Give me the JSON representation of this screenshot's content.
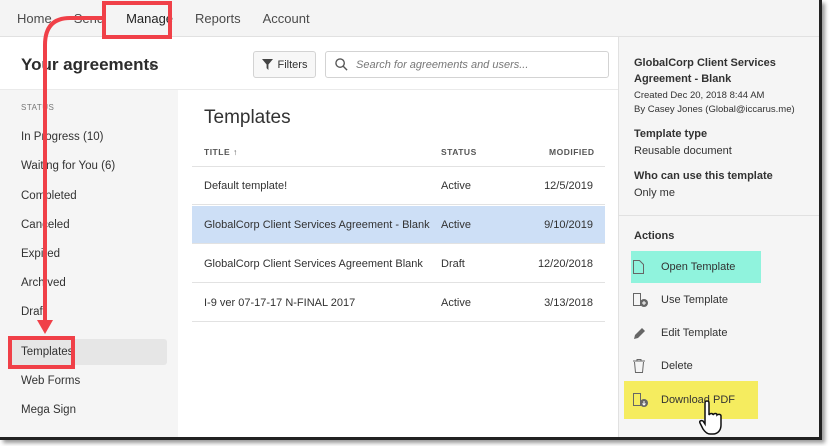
{
  "topnav": [
    "Home",
    "Send",
    "Manage",
    "Reports",
    "Account"
  ],
  "header": {
    "title": "Your agreements",
    "filters": "Filters",
    "search_placeholder": "Search for agreements and users..."
  },
  "sidebar": {
    "section": "STATUS",
    "items": [
      "In Progress (10)",
      "Waiting for You (6)",
      "Completed",
      "Canceled",
      "Expired",
      "Archived",
      "Draft",
      "Templates",
      "Web Forms",
      "Mega Sign"
    ],
    "selected": "Templates"
  },
  "main": {
    "title": "Templates",
    "columns": [
      "TITLE",
      "STATUS",
      "MODIFIED"
    ],
    "rows": [
      {
        "title": "Default template!",
        "status": "Active",
        "modified": "12/5/2019"
      },
      {
        "title": "GlobalCorp Client Services Agreement - Blank",
        "status": "Active",
        "modified": "9/10/2019"
      },
      {
        "title": "GlobalCorp Client Services Agreement Blank",
        "status": "Draft",
        "modified": "12/20/2018"
      },
      {
        "title": "I-9 ver 07-17-17 N-FINAL 2017",
        "status": "Active",
        "modified": "3/13/2018"
      }
    ]
  },
  "details": {
    "name": "GlobalCorp Client Services Agreement - Blank",
    "created": "Created Dec 20, 2018 8:44 AM",
    "by": "By Casey Jones (Global@iccarus.me)",
    "type_label": "Template type",
    "type_value": "Reusable document",
    "who_label": "Who can use this template",
    "who_value": "Only me",
    "actions_label": "Actions",
    "actions": [
      "Open Template",
      "Use Template",
      "Edit Template",
      "Delete",
      "Download PDF"
    ]
  },
  "colors": {
    "highlight_teal": "#90f3dd",
    "highlight_yellow": "#f5ec5f",
    "annotation_red": "#f04048",
    "selected_row": "#cddff6"
  }
}
